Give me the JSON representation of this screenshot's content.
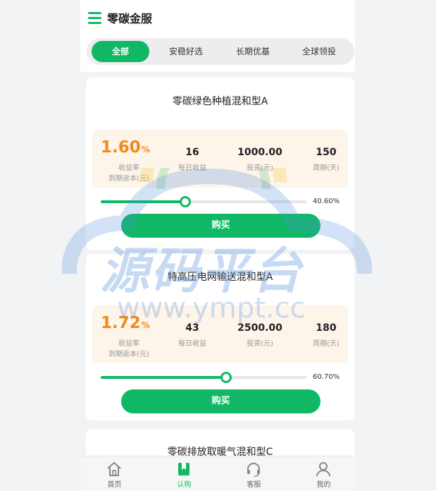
{
  "header": {
    "title": "零碳金服"
  },
  "tabs": [
    {
      "label": "全部",
      "active": true
    },
    {
      "label": "安稳好选",
      "active": false
    },
    {
      "label": "长期优基",
      "active": false
    },
    {
      "label": "全球领投",
      "active": false
    }
  ],
  "products": [
    {
      "name": "零碳绿色种植混和型A",
      "rate": "1.60",
      "rate_unit": "%",
      "rate_label": "收益率",
      "rate_sub": "到期返本(元)",
      "daily": "16",
      "daily_label": "每日收益",
      "invest": "1000.00",
      "invest_label": "投资(元)",
      "period": "150",
      "period_label": "周期(天)",
      "progress_text": "40.60%",
      "progress": 0.406,
      "buy": "购买"
    },
    {
      "name": "特高压电网输送混和型A",
      "rate": "1.72",
      "rate_unit": "%",
      "rate_label": "收益率",
      "rate_sub": "到期返本(元)",
      "daily": "43",
      "daily_label": "每日收益",
      "invest": "2500.00",
      "invest_label": "投资(元)",
      "period": "180",
      "period_label": "周期(天)",
      "progress_text": "60.70%",
      "progress": 0.607,
      "buy": "购买"
    },
    {
      "name": "零碳排放取暖气混和型C"
    }
  ],
  "tabbar": [
    {
      "label": "首页",
      "icon": "home-icon",
      "active": false
    },
    {
      "label": "认购",
      "icon": "bookmark-icon",
      "active": true
    },
    {
      "label": "客服",
      "icon": "headset-icon",
      "active": false
    },
    {
      "label": "我的",
      "icon": "user-icon",
      "active": false
    }
  ],
  "watermark": {
    "line1": "源码平台",
    "line2": "www.ympt.cc"
  },
  "colors": {
    "accent": "#10b865",
    "rate": "#f08a1c",
    "stats_bg": "#fdf4ea"
  }
}
